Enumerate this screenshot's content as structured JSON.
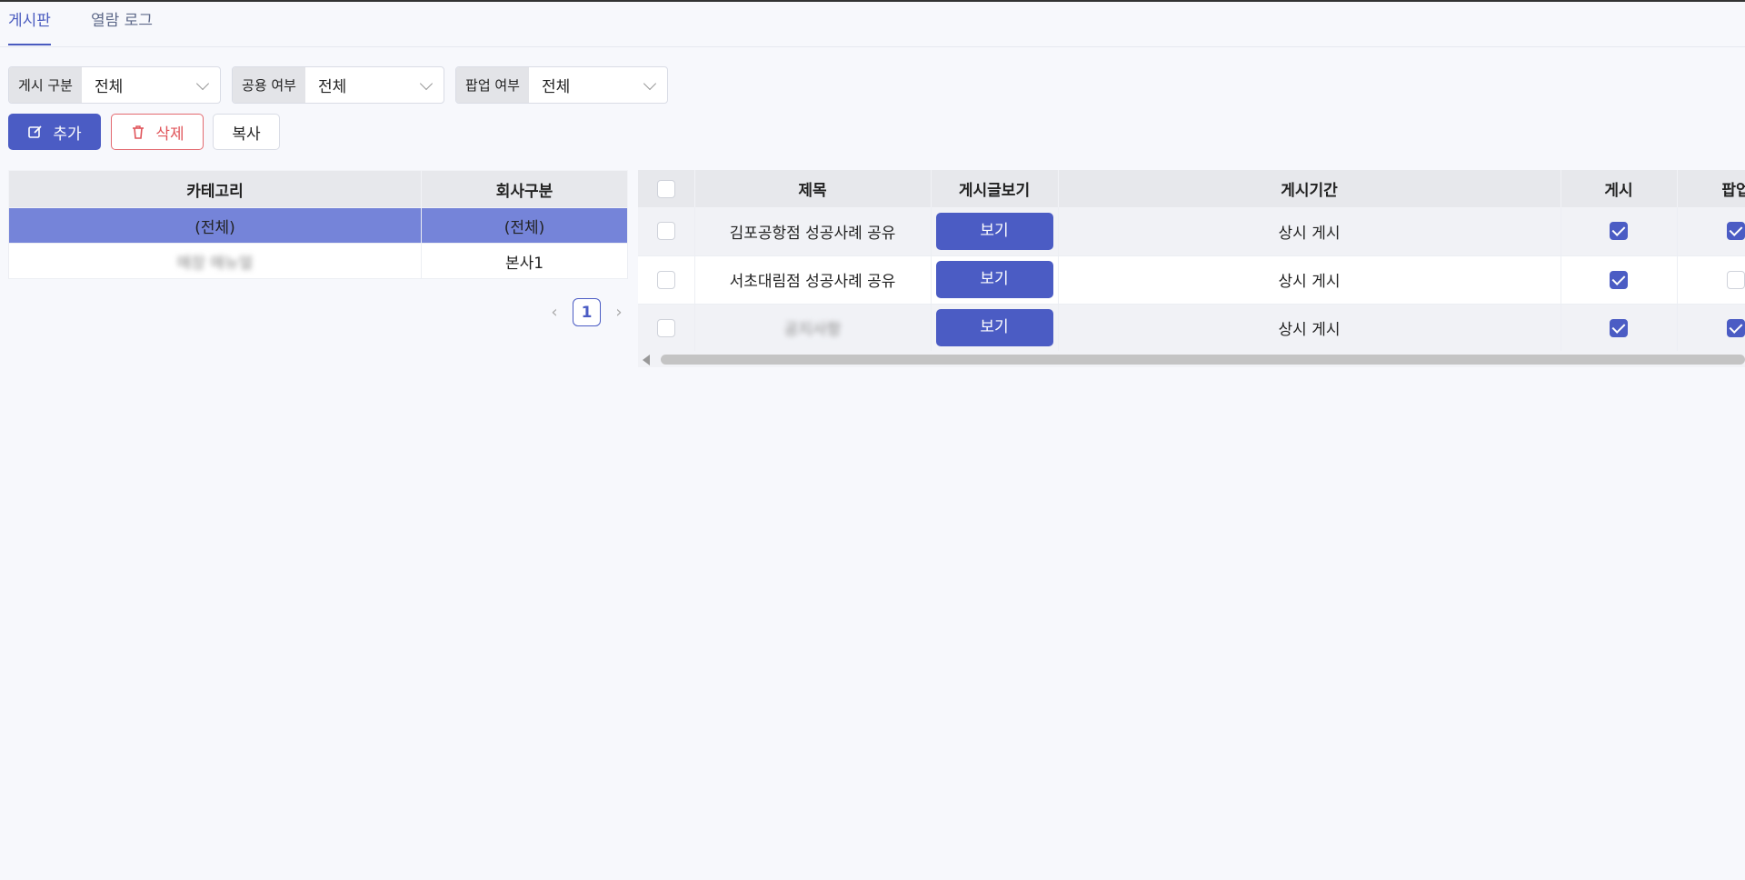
{
  "tabs": [
    {
      "label": "게시판",
      "active": true
    },
    {
      "label": "열람 로그",
      "active": false
    }
  ],
  "filters": [
    {
      "label": "게시 구분",
      "value": "전체"
    },
    {
      "label": "공용 여부",
      "value": "전체"
    },
    {
      "label": "팝업 여부",
      "value": "전체"
    }
  ],
  "toolbar": {
    "add_label": "추가",
    "delete_label": "삭제",
    "copy_label": "복사"
  },
  "category_table": {
    "headers": [
      "카테고리",
      "회사구분"
    ],
    "rows": [
      {
        "category": "(전체)",
        "company": "(전체)",
        "selected": true
      },
      {
        "category": "매장 매뉴얼",
        "company": "본사1",
        "selected": false
      }
    ]
  },
  "pagination": {
    "current": "1"
  },
  "post_table": {
    "headers": [
      "제목",
      "게시글보기",
      "게시기간",
      "게시",
      "팝업"
    ],
    "rows": [
      {
        "title": "김포공항점 성공사례 공유",
        "view_label": "보기",
        "period": "상시 게시",
        "posted": true,
        "popup": true
      },
      {
        "title": "서초대림점 성공사례 공유",
        "view_label": "보기",
        "period": "상시 게시",
        "posted": true,
        "popup": false
      },
      {
        "title": "공지사항",
        "view_label": "보기",
        "period": "상시 게시",
        "posted": true,
        "popup": true
      }
    ]
  },
  "colors": {
    "accent": "#4b5cc4",
    "selected_row": "#7584d9",
    "danger": "#e0555b"
  }
}
